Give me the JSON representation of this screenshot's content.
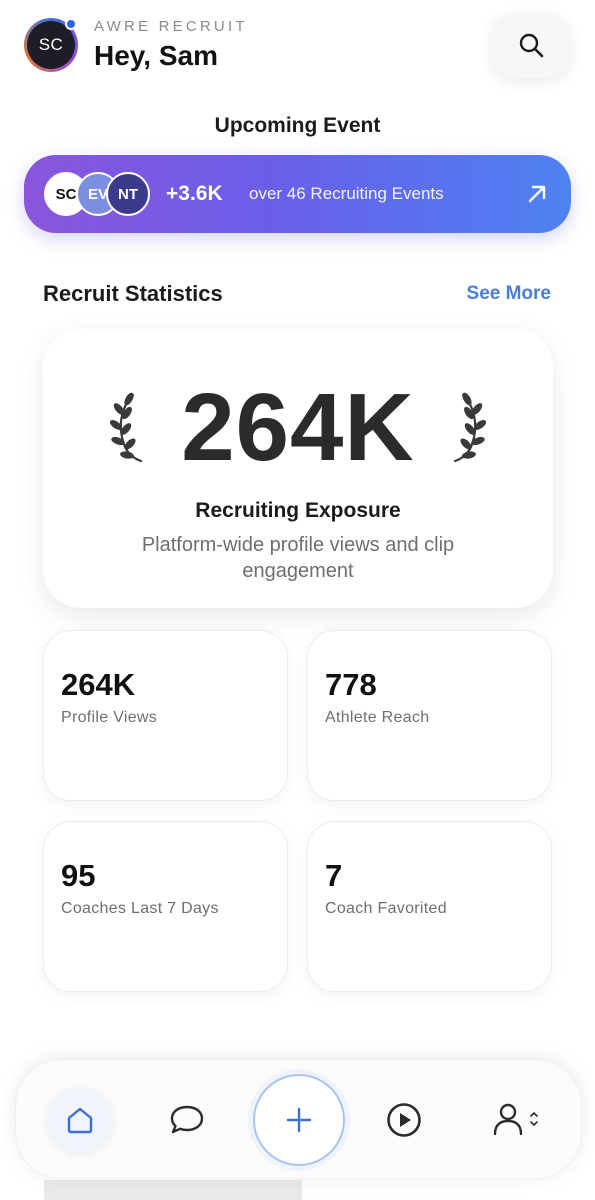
{
  "header": {
    "avatar_initials": "SC",
    "app_name": "AWRE RECRUIT",
    "greeting": "Hey, Sam",
    "search_icon": "search-icon"
  },
  "upcoming": {
    "title": "Upcoming Event",
    "avatars": [
      "SC",
      "EV",
      "NT"
    ],
    "count": "+3.6K",
    "text": "over 46 Recruiting Events",
    "arrow_icon": "arrow-up-right-icon"
  },
  "stats": {
    "title": "Recruit Statistics",
    "see_more": "See More",
    "hero": {
      "value": "264K",
      "label": "Recruiting Exposure",
      "description": "Platform-wide profile views and clip engagement"
    },
    "cards": [
      {
        "value": "264K",
        "label": "Profile Views"
      },
      {
        "value": "778",
        "label": "Athlete Reach"
      },
      {
        "value": "95",
        "label": "Coaches Last 7 Days"
      },
      {
        "value": "7",
        "label": "Coach Favorited"
      }
    ]
  },
  "tab_bar": {
    "items": [
      "home-icon",
      "chat-icon",
      "plus-icon",
      "play-icon",
      "profile-icon"
    ],
    "active": "home"
  },
  "colors": {
    "accent": "#4a7ed8",
    "banner_start": "#8a55dc",
    "banner_end": "#4d82f2",
    "status_dot": "#2f63e6"
  }
}
